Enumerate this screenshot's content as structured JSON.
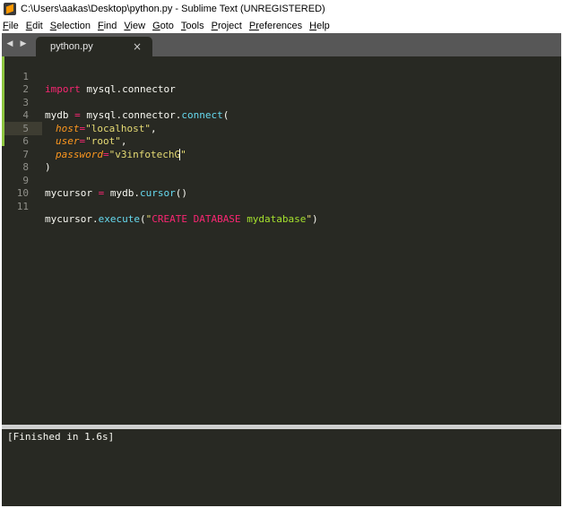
{
  "window": {
    "title": "C:\\Users\\aakas\\Desktop\\python.py - Sublime Text (UNREGISTERED)"
  },
  "menu": [
    {
      "mn": "F",
      "rest": "ile"
    },
    {
      "mn": "E",
      "rest": "dit"
    },
    {
      "mn": "S",
      "rest": "election"
    },
    {
      "mn": "F",
      "rest": "ind"
    },
    {
      "mn": "V",
      "rest": "iew"
    },
    {
      "mn": "G",
      "rest": "oto"
    },
    {
      "mn": "T",
      "rest": "ools"
    },
    {
      "mn": "P",
      "rest": "roject"
    },
    {
      "mn": "Pr",
      "rest": "eferences"
    },
    {
      "mn": "H",
      "rest": "elp"
    }
  ],
  "tab": {
    "label": "python.py",
    "close": "×"
  },
  "icons": {
    "back": "◀",
    "forward": "▶"
  },
  "line_numbers": [
    "1",
    "2",
    "3",
    "4",
    "5",
    "6",
    "7",
    "8",
    "9",
    "10",
    "11"
  ],
  "code": {
    "l1_kw": "import",
    "l1_rest": " mysql.connector",
    "l3_a": "mydb ",
    "l3_eq": "=",
    "l3_b": " mysql.connector.",
    "l3_fn": "connect",
    "l3_paren": "(",
    "l4_arg": "host",
    "l4_eq": "=",
    "l4_str": "\"localhost\"",
    "l4_end": ",",
    "l5_arg": "user",
    "l5_eq": "=",
    "l5_str": "\"root\"",
    "l5_end": ",",
    "l6_arg": "password",
    "l6_eq": "=",
    "l6_str_a": "\"v3infotechG",
    "l6_str_b": "\"",
    "l7": ")",
    "l9_a": "mycursor ",
    "l9_eq": "=",
    "l9_b": " mydb.",
    "l9_fn": "cursor",
    "l9_c": "()",
    "l11_a": "mycursor.",
    "l11_fn": "execute",
    "l11_p": "(",
    "l11_q1": "\"",
    "l11_sql": "CREATE DATABASE",
    "l11_sp": " ",
    "l11_id": "mydatabase",
    "l11_q2": "\"",
    "l11_end": ")"
  },
  "output": {
    "text": "[Finished in 1.6s]"
  },
  "colors": {
    "editor_bg": "#282923",
    "keyword": "#f92672",
    "function": "#66d9ef",
    "string": "#e6db74",
    "argument": "#fd971f",
    "sql_identifier": "#a6e22e",
    "modified_marker": "#8dc63f"
  }
}
